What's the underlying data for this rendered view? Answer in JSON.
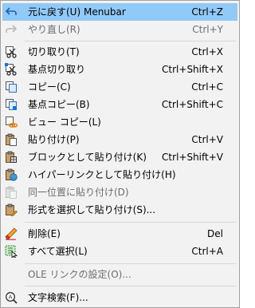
{
  "menu": {
    "items": [
      {
        "label": "元に戻す(U) Menubar",
        "shortcut": "Ctrl+Z",
        "icon": "undo-icon",
        "enabled": true,
        "highlighted": true
      },
      {
        "label": "やり直し(R)",
        "shortcut": "Ctrl+Y",
        "icon": "redo-icon",
        "enabled": false
      },
      {
        "label": "切り取り(T)",
        "shortcut": "Ctrl+X",
        "icon": "cut-icon",
        "enabled": true
      },
      {
        "label": "基点切り取り",
        "shortcut": "Ctrl+Shift+X",
        "icon": "cut-with-basepoint-icon",
        "enabled": true
      },
      {
        "label": "コピー(C)",
        "shortcut": "Ctrl+C",
        "icon": "copy-icon",
        "enabled": true
      },
      {
        "label": "基点コピー(B)",
        "shortcut": "Ctrl+Shift+C",
        "icon": "copy-with-basepoint-icon",
        "enabled": true
      },
      {
        "label": "ビュー コピー(L)",
        "shortcut": "",
        "icon": "copy-link-icon",
        "enabled": true
      },
      {
        "label": "貼り付け(P)",
        "shortcut": "Ctrl+V",
        "icon": "paste-icon",
        "enabled": true
      },
      {
        "label": "ブロックとして貼り付け(K)",
        "shortcut": "Ctrl+Shift+V",
        "icon": "paste-as-block-icon",
        "enabled": true
      },
      {
        "label": "ハイパーリンクとして貼り付け(H)",
        "shortcut": "",
        "icon": "paste-as-hyperlink-icon",
        "enabled": true
      },
      {
        "label": "同一位置に貼り付け(D)",
        "shortcut": "",
        "icon": "paste-to-original-icon",
        "enabled": false
      },
      {
        "label": "形式を選択して貼り付け(S)...",
        "shortcut": "",
        "icon": "paste-special-icon",
        "enabled": true
      },
      {
        "label": "削除(E)",
        "shortcut": "Del",
        "icon": "erase-icon",
        "enabled": true
      },
      {
        "label": "すべて選択(L)",
        "shortcut": "Ctrl+A",
        "icon": "select-all-icon",
        "enabled": true
      },
      {
        "label": "OLE リンクの設定(O)...",
        "shortcut": "",
        "icon": "",
        "enabled": false
      },
      {
        "label": "文字検索(F)...",
        "shortcut": "",
        "icon": "find-text-icon",
        "enabled": true
      }
    ]
  }
}
